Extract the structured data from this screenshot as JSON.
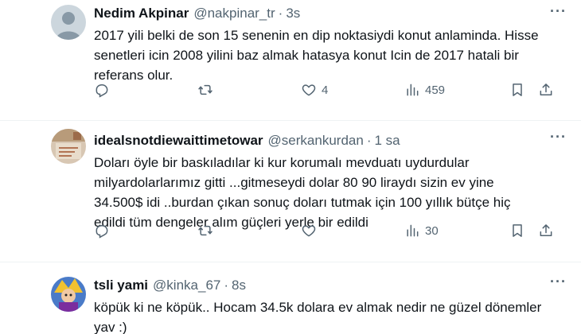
{
  "tweets": [
    {
      "name": "Nedim Akpinar",
      "handle": "@nakpinar_tr",
      "time": "3s",
      "text": "2017 yili belki de son 15 senenin en dip noktasiydi konut anlaminda. Hisse\nsenetleri icin 2008 yilini baz almak hatasya konut Icin de 2017 hatali bir\nreferans olur.",
      "replies": "",
      "retweets": "",
      "likes": "4",
      "views": "459"
    },
    {
      "name": "idealsnotdiewaittimetowar",
      "handle": "@serkankurdan",
      "time": "1 sa",
      "text": "Doları öyle bir baskıladılar ki kur korumalı mevduatı uydurdular\nmilyardolarlarımız gitti ...gitmeseydi dolar 80 90 liraydı sizin ev yine\n34.500$ idi ..burdan çıkan sonuç doları tutmak için 100 yıllık bütçe hiç\nedildi tüm dengeler alım güçleri yerle bir edildi",
      "replies": "",
      "retweets": "",
      "likes": "",
      "views": "30"
    },
    {
      "name": "tsli yami",
      "handle": "@kinka_67",
      "time": "8s",
      "text": "köpük ki ne köpük.. Hocam 34.5k dolara ev almak nedir ne güzel dönemler\nyav :)"
    }
  ],
  "ui": {
    "separator": "·",
    "more": "···",
    "accent": "#1d9bf0",
    "icons": [
      "reply-icon",
      "retweet-icon",
      "like-icon",
      "views-icon",
      "bookmark-icon",
      "share-icon"
    ]
  }
}
